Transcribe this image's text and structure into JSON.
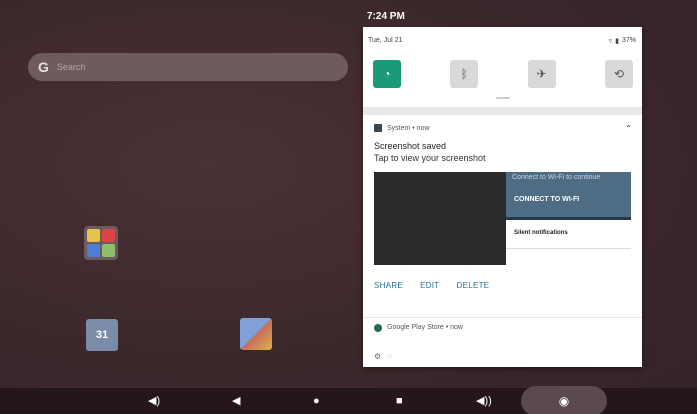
{
  "status_bar": {
    "time": "7:24 PM"
  },
  "home": {
    "search_brand": "G",
    "search_placeholder": "Search",
    "calendar_label": "31"
  },
  "quick_settings": {
    "date": "Tue, Jul 21",
    "battery": "37%",
    "tiles": [
      {
        "icon": "wifi-icon",
        "active": true
      },
      {
        "icon": "bluetooth-icon",
        "active": false
      },
      {
        "icon": "airplane-icon",
        "active": false
      },
      {
        "icon": "auto-rotate-icon",
        "active": false
      }
    ]
  },
  "notification": {
    "app": "System • now",
    "title": "Screenshot saved",
    "text": "Tap to view your screenshot",
    "preview": {
      "wifi_prompt": "Connect to Wi-Fi to continue",
      "wifi_button": "CONNECT TO WI-FI",
      "silent": "Silent notifications"
    },
    "actions": {
      "share": "SHARE",
      "edit": "EDIT",
      "delete": "DELETE"
    }
  },
  "play_notification": {
    "app": "Google Play Store • now"
  },
  "nav": {
    "volume_down": "◀)",
    "back": "◀",
    "home": "●",
    "recents": "■",
    "volume_up": "◀))",
    "screenshot": "◉"
  },
  "colors": {
    "accent": "#1a9a78",
    "action": "#2a6f98",
    "wallpaper": "#3f2a2d"
  }
}
